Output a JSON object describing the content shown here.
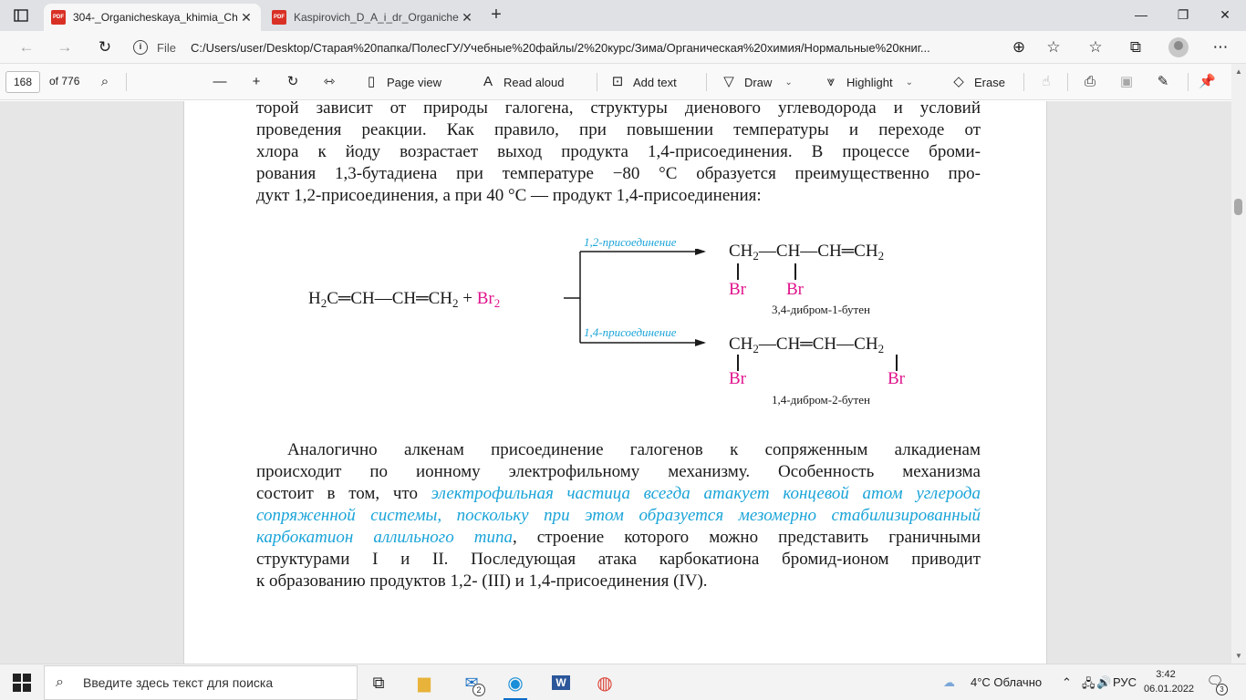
{
  "browser": {
    "tabs": [
      {
        "title": "304-_Organicheskaya_khimia_Ch",
        "icon": "pdf-icon",
        "active": true
      },
      {
        "title": "Kaspirovich_D_A_i_dr_Organiche",
        "icon": "pdf-icon",
        "active": false
      }
    ],
    "new_tab": "+",
    "file_label": "File",
    "url": "C:/Users/user/Desktop/Старая%20папка/ПолесГУ/Учебные%20файлы/2%20курс/Зима/Органическая%20химия/Нормальные%20книг..."
  },
  "pdf_toolbar": {
    "page_number": "168",
    "page_count": "of 776",
    "page_view": "Page view",
    "read_aloud": "Read aloud",
    "add_text": "Add text",
    "draw": "Draw",
    "highlight": "Highlight",
    "erase": "Erase"
  },
  "document": {
    "para1_lines": [
      "торой зависит от природы галогена, структуры диенового углеводорода и условий",
      "проведения реакции. Как правило, при повышении температуры и переходе от",
      "хлора к йоду возрастает выход продукта 1,4-присоединения. В процессе броми-",
      "рования 1,3-бутадиена при температуре −80 °С образуется преимущественно про-",
      "дукт 1,2-присоединения, а при 40 °С — продукт 1,4-присоединения:"
    ],
    "reaction": {
      "reactant_main": "H2C═CH—CH═CH2",
      "plus": "+",
      "reagent": "Br2",
      "path1_label": "1,2-присоединение",
      "path2_label": "1,4-присоединение",
      "product1_formula": "CH2—CH—CH═CH2",
      "product1_subst": "Br",
      "product1_name": "3,4-дибром-1-бутен",
      "product2_formula": "CH2—CH═CH—CH2",
      "product2_subst": "Br",
      "product2_name": "1,4-дибром-2-бутен"
    },
    "para2": {
      "l1": "Аналогично алкенам присоединение галогенов к сопряженным алкадиенам",
      "l2": "происходит по ионному электрофильному механизму. Особенность механизма",
      "l3_a": "состоит в том, что ",
      "l3_b": "электрофильная частица всегда атакует концевой атом углерода",
      "l4": "сопряженной системы, поскольку при этом образуется мезомерно стабилизированный",
      "l5_a": "карбокатион аллильного типа",
      "l5_b": ", строение которого можно представить граничными",
      "l6": "структурами I и II. Последующая атака карбокатиона бромид-ионом приводит",
      "l7": "к образованию продуктов 1,2- (III) и 1,4-присоединения (IV)."
    },
    "colors": {
      "highlight_text": "#1aa4d8",
      "bromine": "#e0148c"
    }
  },
  "taskbar": {
    "search_placeholder": "Введите здесь текст для поиска",
    "mail_badge": "2",
    "weather": "4°C  Облачно",
    "language": "РУС",
    "time": "3:42",
    "date": "06.01.2022",
    "notifications": "3"
  }
}
